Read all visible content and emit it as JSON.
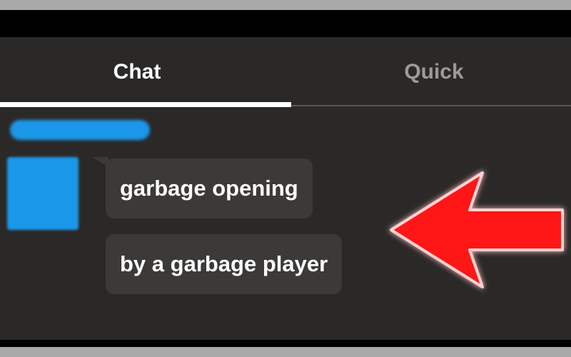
{
  "tabs": [
    {
      "label": "Chat",
      "active": true
    },
    {
      "label": "Quick",
      "active": false
    }
  ],
  "messages": [
    {
      "text": "garbage opening"
    },
    {
      "text": "by a garbage player"
    }
  ],
  "colors": {
    "panel_background": "#2b2927",
    "bubble_background": "#3c3a38",
    "blurred_identity": "#1a97e8",
    "arrow_red": "#ff1414"
  },
  "icons": {
    "annotation": "red-arrow-left-icon"
  }
}
